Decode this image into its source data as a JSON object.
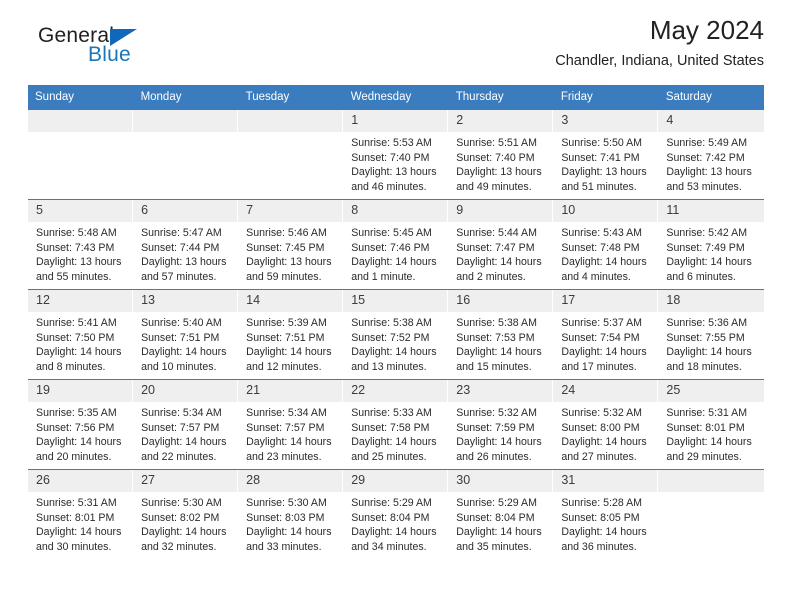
{
  "brand": {
    "name_part1": "General",
    "name_part2": "Blue",
    "triangle_color": "#1168ba",
    "blue_color": "#1b75bb"
  },
  "header": {
    "title": "May 2024",
    "subtitle": "Chandler, Indiana, United States"
  },
  "colors": {
    "header_blue": "#3a7cbe",
    "day_band_gray": "#efefef",
    "text": "#2b2b2b"
  },
  "weekdays": [
    "Sunday",
    "Monday",
    "Tuesday",
    "Wednesday",
    "Thursday",
    "Friday",
    "Saturday"
  ],
  "weeks": [
    [
      {
        "empty": true
      },
      {
        "empty": true
      },
      {
        "empty": true
      },
      {
        "day": "1",
        "sunrise": "Sunrise: 5:53 AM",
        "sunset": "Sunset: 7:40 PM",
        "daylight_1": "Daylight: 13 hours",
        "daylight_2": "and 46 minutes."
      },
      {
        "day": "2",
        "sunrise": "Sunrise: 5:51 AM",
        "sunset": "Sunset: 7:40 PM",
        "daylight_1": "Daylight: 13 hours",
        "daylight_2": "and 49 minutes."
      },
      {
        "day": "3",
        "sunrise": "Sunrise: 5:50 AM",
        "sunset": "Sunset: 7:41 PM",
        "daylight_1": "Daylight: 13 hours",
        "daylight_2": "and 51 minutes."
      },
      {
        "day": "4",
        "sunrise": "Sunrise: 5:49 AM",
        "sunset": "Sunset: 7:42 PM",
        "daylight_1": "Daylight: 13 hours",
        "daylight_2": "and 53 minutes."
      }
    ],
    [
      {
        "day": "5",
        "sunrise": "Sunrise: 5:48 AM",
        "sunset": "Sunset: 7:43 PM",
        "daylight_1": "Daylight: 13 hours",
        "daylight_2": "and 55 minutes."
      },
      {
        "day": "6",
        "sunrise": "Sunrise: 5:47 AM",
        "sunset": "Sunset: 7:44 PM",
        "daylight_1": "Daylight: 13 hours",
        "daylight_2": "and 57 minutes."
      },
      {
        "day": "7",
        "sunrise": "Sunrise: 5:46 AM",
        "sunset": "Sunset: 7:45 PM",
        "daylight_1": "Daylight: 13 hours",
        "daylight_2": "and 59 minutes."
      },
      {
        "day": "8",
        "sunrise": "Sunrise: 5:45 AM",
        "sunset": "Sunset: 7:46 PM",
        "daylight_1": "Daylight: 14 hours",
        "daylight_2": "and 1 minute."
      },
      {
        "day": "9",
        "sunrise": "Sunrise: 5:44 AM",
        "sunset": "Sunset: 7:47 PM",
        "daylight_1": "Daylight: 14 hours",
        "daylight_2": "and 2 minutes."
      },
      {
        "day": "10",
        "sunrise": "Sunrise: 5:43 AM",
        "sunset": "Sunset: 7:48 PM",
        "daylight_1": "Daylight: 14 hours",
        "daylight_2": "and 4 minutes."
      },
      {
        "day": "11",
        "sunrise": "Sunrise: 5:42 AM",
        "sunset": "Sunset: 7:49 PM",
        "daylight_1": "Daylight: 14 hours",
        "daylight_2": "and 6 minutes."
      }
    ],
    [
      {
        "day": "12",
        "sunrise": "Sunrise: 5:41 AM",
        "sunset": "Sunset: 7:50 PM",
        "daylight_1": "Daylight: 14 hours",
        "daylight_2": "and 8 minutes."
      },
      {
        "day": "13",
        "sunrise": "Sunrise: 5:40 AM",
        "sunset": "Sunset: 7:51 PM",
        "daylight_1": "Daylight: 14 hours",
        "daylight_2": "and 10 minutes."
      },
      {
        "day": "14",
        "sunrise": "Sunrise: 5:39 AM",
        "sunset": "Sunset: 7:51 PM",
        "daylight_1": "Daylight: 14 hours",
        "daylight_2": "and 12 minutes."
      },
      {
        "day": "15",
        "sunrise": "Sunrise: 5:38 AM",
        "sunset": "Sunset: 7:52 PM",
        "daylight_1": "Daylight: 14 hours",
        "daylight_2": "and 13 minutes."
      },
      {
        "day": "16",
        "sunrise": "Sunrise: 5:38 AM",
        "sunset": "Sunset: 7:53 PM",
        "daylight_1": "Daylight: 14 hours",
        "daylight_2": "and 15 minutes."
      },
      {
        "day": "17",
        "sunrise": "Sunrise: 5:37 AM",
        "sunset": "Sunset: 7:54 PM",
        "daylight_1": "Daylight: 14 hours",
        "daylight_2": "and 17 minutes."
      },
      {
        "day": "18",
        "sunrise": "Sunrise: 5:36 AM",
        "sunset": "Sunset: 7:55 PM",
        "daylight_1": "Daylight: 14 hours",
        "daylight_2": "and 18 minutes."
      }
    ],
    [
      {
        "day": "19",
        "sunrise": "Sunrise: 5:35 AM",
        "sunset": "Sunset: 7:56 PM",
        "daylight_1": "Daylight: 14 hours",
        "daylight_2": "and 20 minutes."
      },
      {
        "day": "20",
        "sunrise": "Sunrise: 5:34 AM",
        "sunset": "Sunset: 7:57 PM",
        "daylight_1": "Daylight: 14 hours",
        "daylight_2": "and 22 minutes."
      },
      {
        "day": "21",
        "sunrise": "Sunrise: 5:34 AM",
        "sunset": "Sunset: 7:57 PM",
        "daylight_1": "Daylight: 14 hours",
        "daylight_2": "and 23 minutes."
      },
      {
        "day": "22",
        "sunrise": "Sunrise: 5:33 AM",
        "sunset": "Sunset: 7:58 PM",
        "daylight_1": "Daylight: 14 hours",
        "daylight_2": "and 25 minutes."
      },
      {
        "day": "23",
        "sunrise": "Sunrise: 5:32 AM",
        "sunset": "Sunset: 7:59 PM",
        "daylight_1": "Daylight: 14 hours",
        "daylight_2": "and 26 minutes."
      },
      {
        "day": "24",
        "sunrise": "Sunrise: 5:32 AM",
        "sunset": "Sunset: 8:00 PM",
        "daylight_1": "Daylight: 14 hours",
        "daylight_2": "and 27 minutes."
      },
      {
        "day": "25",
        "sunrise": "Sunrise: 5:31 AM",
        "sunset": "Sunset: 8:01 PM",
        "daylight_1": "Daylight: 14 hours",
        "daylight_2": "and 29 minutes."
      }
    ],
    [
      {
        "day": "26",
        "sunrise": "Sunrise: 5:31 AM",
        "sunset": "Sunset: 8:01 PM",
        "daylight_1": "Daylight: 14 hours",
        "daylight_2": "and 30 minutes."
      },
      {
        "day": "27",
        "sunrise": "Sunrise: 5:30 AM",
        "sunset": "Sunset: 8:02 PM",
        "daylight_1": "Daylight: 14 hours",
        "daylight_2": "and 32 minutes."
      },
      {
        "day": "28",
        "sunrise": "Sunrise: 5:30 AM",
        "sunset": "Sunset: 8:03 PM",
        "daylight_1": "Daylight: 14 hours",
        "daylight_2": "and 33 minutes."
      },
      {
        "day": "29",
        "sunrise": "Sunrise: 5:29 AM",
        "sunset": "Sunset: 8:04 PM",
        "daylight_1": "Daylight: 14 hours",
        "daylight_2": "and 34 minutes."
      },
      {
        "day": "30",
        "sunrise": "Sunrise: 5:29 AM",
        "sunset": "Sunset: 8:04 PM",
        "daylight_1": "Daylight: 14 hours",
        "daylight_2": "and 35 minutes."
      },
      {
        "day": "31",
        "sunrise": "Sunrise: 5:28 AM",
        "sunset": "Sunset: 8:05 PM",
        "daylight_1": "Daylight: 14 hours",
        "daylight_2": "and 36 minutes."
      },
      {
        "empty": true
      }
    ]
  ]
}
